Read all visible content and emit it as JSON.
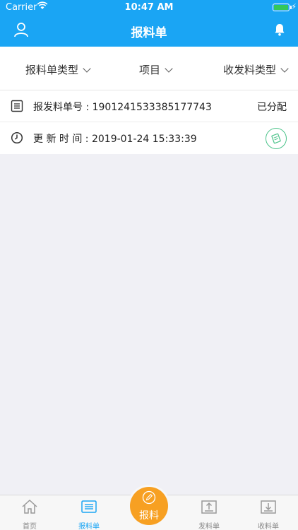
{
  "status_bar": {
    "carrier": "Carrier",
    "time": "10:47 AM"
  },
  "header": {
    "title": "报料单",
    "left_icon": "user-icon",
    "right_icon": "bell-icon"
  },
  "filters": [
    {
      "label": "报料单类型"
    },
    {
      "label": "项目"
    },
    {
      "label": "收发料类型"
    }
  ],
  "record": {
    "number_label": "报发料单号 : 1901241533385177743",
    "status": "已分配",
    "time_label": "更 新 时 间 : 2019-01-24 15:33:39"
  },
  "tabbar": {
    "items": [
      {
        "label": "首页",
        "icon": "home-icon"
      },
      {
        "label": "报料单",
        "icon": "list-icon"
      },
      {
        "label": "发料单",
        "icon": "upload-tray-icon"
      },
      {
        "label": "收料单",
        "icon": "download-tray-icon"
      }
    ],
    "fab_label": "报料"
  },
  "colors": {
    "brand": "#1aa5f4",
    "fab": "#f7a022",
    "stamp": "#4cc38a"
  }
}
